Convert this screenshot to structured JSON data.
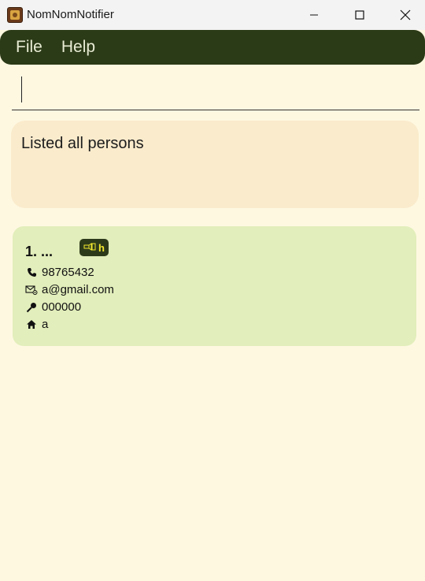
{
  "window": {
    "title": "NomNomNotifier"
  },
  "menu": {
    "file_label": "File",
    "help_label": "Help"
  },
  "command": {
    "value": ""
  },
  "result": {
    "message": "Listed all persons"
  },
  "persons": [
    {
      "index_name": "1. ...",
      "tag": "h",
      "phone": "98765432",
      "email": "a@gmail.com",
      "postal": "000000",
      "address": "a"
    }
  ],
  "colors": {
    "menubar": "#2b3a17",
    "result_bg": "#faebcc",
    "card_bg": "#e2eebb",
    "tag_bg": "#2d3a1a",
    "tag_text": "#f3e82f",
    "page_bg": "#fef8e1"
  },
  "icons": {
    "phone": "phone-icon",
    "email": "email-icon",
    "postal": "pin-icon",
    "address": "home-icon",
    "tag": "tag-icon"
  }
}
